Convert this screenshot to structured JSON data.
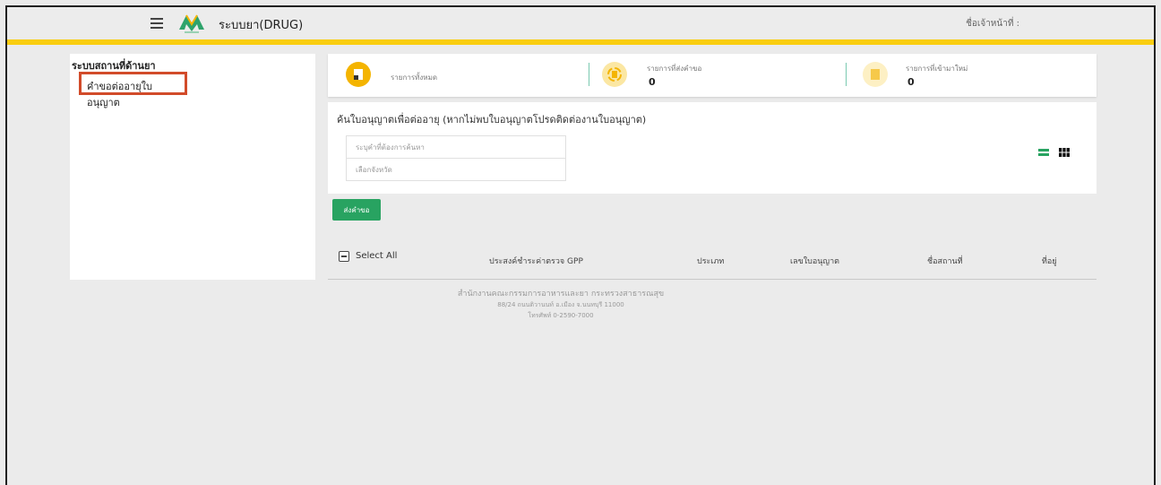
{
  "header": {
    "app_title": "ระบบยา(DRUG)",
    "officer_label": "ชื่อเจ้าหน้าที่ :",
    "logo_name": "logo-icon"
  },
  "sidebar": {
    "title": "ระบบสถานที่ด้านยา",
    "items": [
      {
        "label": "คำขอต่ออายุใบอนุญาต"
      }
    ]
  },
  "stats": [
    {
      "label": "รายการทั้งหมด",
      "value": "",
      "icon": "document-icon",
      "color": "#f4b400"
    },
    {
      "label": "รายการที่ส่งคำขอ",
      "value": "0",
      "icon": "refresh-document-icon",
      "color": "#f4b400"
    },
    {
      "label": "รายการที่เข้ามาใหม่",
      "value": "0",
      "icon": "new-document-icon",
      "color": "#f6c94a"
    }
  ],
  "search": {
    "heading": "ค้นใบอนุญาตเพื่อต่ออายุ (หากไม่พบใบอนุญาตโปรดติดต่องานใบอนุญาต)",
    "keyword_placeholder": "ระบุคำที่ต้องการค้นหา",
    "province_placeholder": "เลือกจังหวัด"
  },
  "submit_label": "ส่งคำขอ",
  "table": {
    "select_all": "Select All",
    "columns": [
      "ประสงค์ชำระค่าตรวจ GPP",
      "ประเภท",
      "เลขใบอนุญาต",
      "ชื่อสถานที่",
      "ที่อยู่"
    ]
  },
  "footer": {
    "org": "สำนักงานคณะกรรมการอาหารและยา กระทรวงสาธารณสุข",
    "address": "88/24 ถนนติวานนท์ อ.เมือง จ.นนทบุรี 11000",
    "phone": "โทรศัพท์ 0-2590-7000"
  },
  "colors": {
    "accent_yellow": "#f9cd10",
    "green": "#28a361",
    "highlight_red": "#d24b2a"
  }
}
